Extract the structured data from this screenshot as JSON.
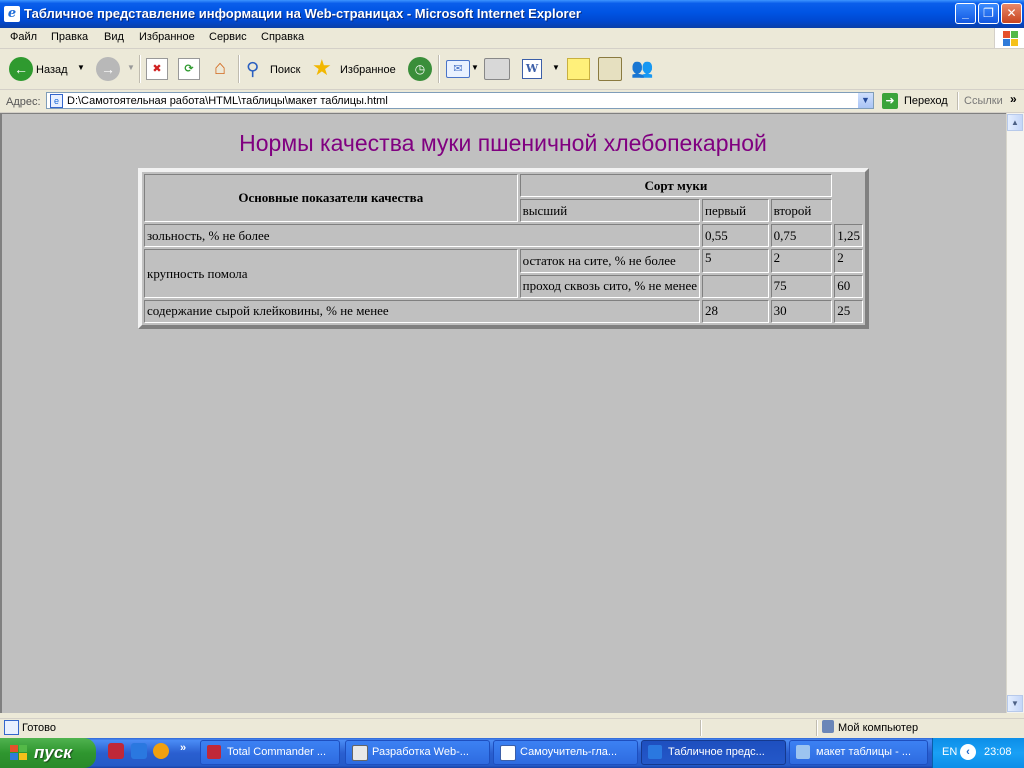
{
  "window": {
    "title": "Табличное представление информации на Web-страницах - Microsoft Internet Explorer",
    "app_icon_glyph": "e"
  },
  "menu": [
    "Файл",
    "Правка",
    "Вид",
    "Избранное",
    "Сервис",
    "Справка"
  ],
  "toolbar": {
    "back_label": "Назад",
    "search_label": "Поиск",
    "favorites_label": "Избранное"
  },
  "address": {
    "label": "Адрес:",
    "value": "D:\\Самотоятельная работа\\HTML\\таблицы\\макет таблицы.html",
    "go_label": "Переход",
    "links_label": "Ссылки"
  },
  "page": {
    "heading": "Нормы качества муки пшеничной хлебопекарной",
    "heading_color": "#800080",
    "table": {
      "header_main": "Основные показатели качества",
      "header_group": "Сорт муки",
      "grades": [
        "высший",
        "первый",
        "второй"
      ],
      "rows": {
        "ash": {
          "label": "зольность, % не более",
          "values": [
            "0,55",
            "0,75",
            "1,25"
          ]
        },
        "grind": {
          "label": "крупность помола",
          "sub1": {
            "label": "остаток на сите, % не более",
            "values": [
              "5",
              "2",
              "2"
            ]
          },
          "sub2": {
            "label": "проход сквозь сито, % не менее",
            "values": [
              "",
              "75",
              "60"
            ]
          }
        },
        "gluten": {
          "label": "содержание сырой клейковины, % не менее",
          "values": [
            "28",
            "30",
            "25"
          ]
        }
      }
    }
  },
  "status": {
    "text": "Готово",
    "zone": "Мой компьютер"
  },
  "taskbar": {
    "start_label": "пуск",
    "tasks": [
      "Total Commander ...",
      "Разработка Web-...",
      "Самоучитель-гла...",
      "Табличное предс...",
      "макет таблицы - ..."
    ],
    "lang": "EN",
    "clock": "23:08"
  }
}
